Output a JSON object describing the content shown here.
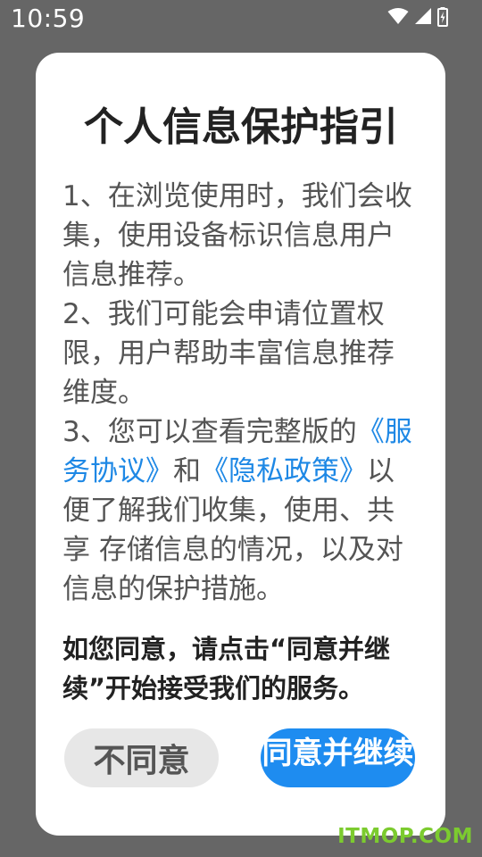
{
  "status_bar": {
    "time": "10:59",
    "icons": [
      "wifi-icon",
      "signal-icon",
      "battery-charging-icon"
    ]
  },
  "dialog": {
    "title": "个人信息保护指引",
    "item1": "1、在浏览使用时，我们会收集，使用设备标识信息用户信息推荐。",
    "item2": "2、我们可能会申请位置权限，用户帮助丰富信息推荐维度。",
    "item3_prefix": "3、您可以查看完整版的",
    "link_service_agreement": "《服务协议》",
    "item3_and": "和",
    "link_privacy_policy": "《隐私政策》",
    "item3_suffix": "以便了解我们收集，使用、共享 存储信息的情况，以及对信息的保护措施。",
    "confirm_text": "如您同意，请点击“同意并继续”开始接受我们的服务。",
    "decline_button": "不同意",
    "agree_button": "同意并继续"
  },
  "watermark": "ITMOP.COM",
  "colors": {
    "overlay": "#666666",
    "dialog_bg": "#ffffff",
    "link": "#1e88e5",
    "agree_button": "#1e8cf0",
    "decline_button": "#e7e7e7",
    "watermark": "#7ccb2f"
  }
}
